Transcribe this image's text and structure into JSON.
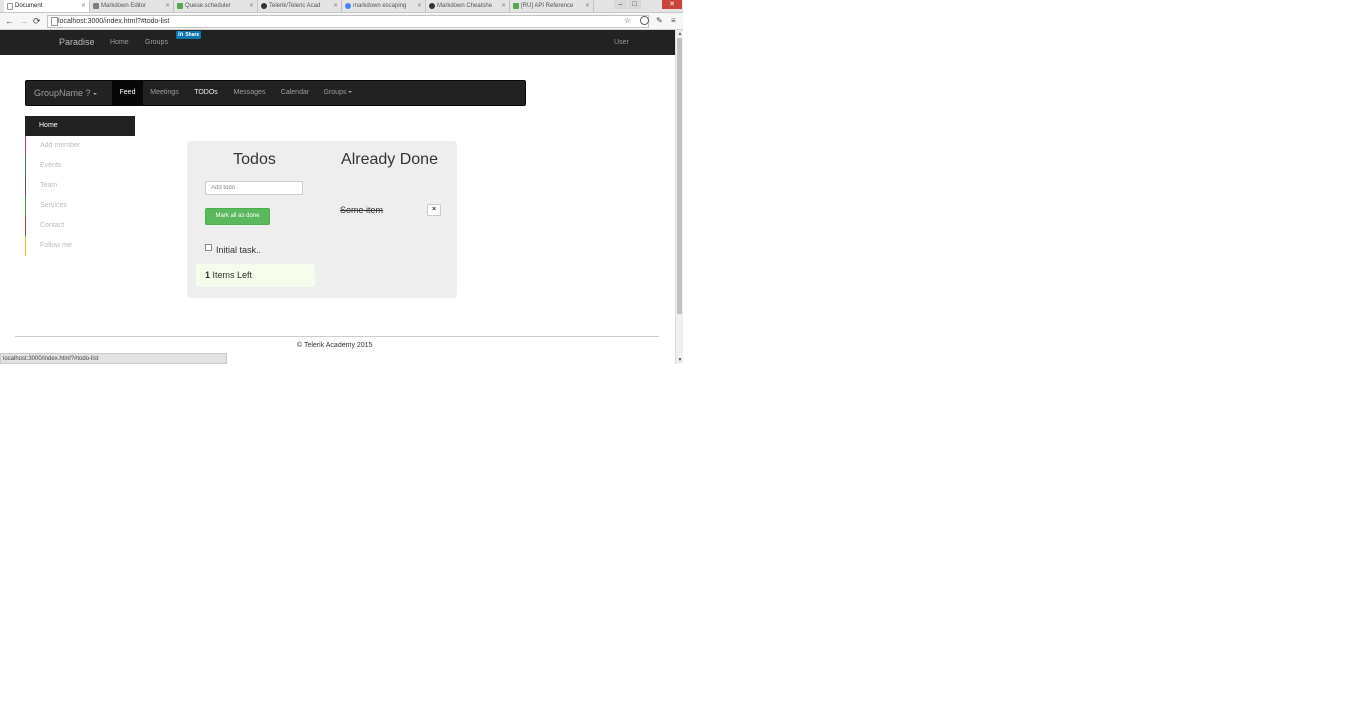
{
  "browser": {
    "tabs": [
      {
        "label": "Document",
        "fav_color": "#ffffff"
      },
      {
        "label": "Markdown Editor",
        "fav_color": "#7f7f7f"
      },
      {
        "label": "Queue.scheduler",
        "fav_color": "#5aa55a"
      },
      {
        "label": "Telerik/Teleric Acad",
        "fav_color": "#333333"
      },
      {
        "label": "markdown escaping",
        "fav_color": "#4285f4"
      },
      {
        "label": "Markdown Cheatshe",
        "fav_color": "#333333"
      },
      {
        "label": "[RU] API Reference",
        "fav_color": "#5aa55a"
      }
    ],
    "url": "localhost:3000/index.html?#todo-list",
    "back_icon": "←",
    "forward_icon": "→",
    "reload_icon": "⟳",
    "minimize_icon": "–",
    "maximize_icon": "□",
    "close_icon": "✕",
    "bookmark_icon": "☆",
    "menu_icon": "≡"
  },
  "topnav": {
    "brand": "Paradise",
    "links": [
      "Home",
      "Groups"
    ],
    "share_label": "Share",
    "share_in": "in",
    "user_label": "User"
  },
  "groupnav": {
    "group_name": "GroupName ?",
    "items": [
      "Feed",
      "Meetings",
      "TODOs",
      "Messages",
      "Calendar",
      "Groups"
    ]
  },
  "sidebar": {
    "items": [
      {
        "label": "Home",
        "accent": "#222222"
      },
      {
        "label": "Add member",
        "accent": "#c0396b"
      },
      {
        "label": "Events",
        "accent": "#3a6fb0"
      },
      {
        "label": "Team",
        "accent": "#6a3d9a"
      },
      {
        "label": "Services",
        "accent": "#3aa03a"
      },
      {
        "label": "Contact",
        "accent": "#b03a3a"
      },
      {
        "label": "Follow me",
        "accent": "#e0c020"
      }
    ]
  },
  "todos": {
    "title": "Todos",
    "input_placeholder": "Add todo",
    "mark_all_label": "Mark all as done",
    "items": [
      {
        "label": "Initial task.."
      }
    ],
    "items_left_count": "1",
    "items_left_label": "Items Left"
  },
  "done": {
    "title": "Already Done",
    "items": [
      {
        "label": "Some item"
      }
    ],
    "delete_icon": "×"
  },
  "footer": {
    "text": "© Telerik Academy 2015"
  },
  "status_bar": {
    "text": "localhost:3000/index.html?#todo-list"
  }
}
